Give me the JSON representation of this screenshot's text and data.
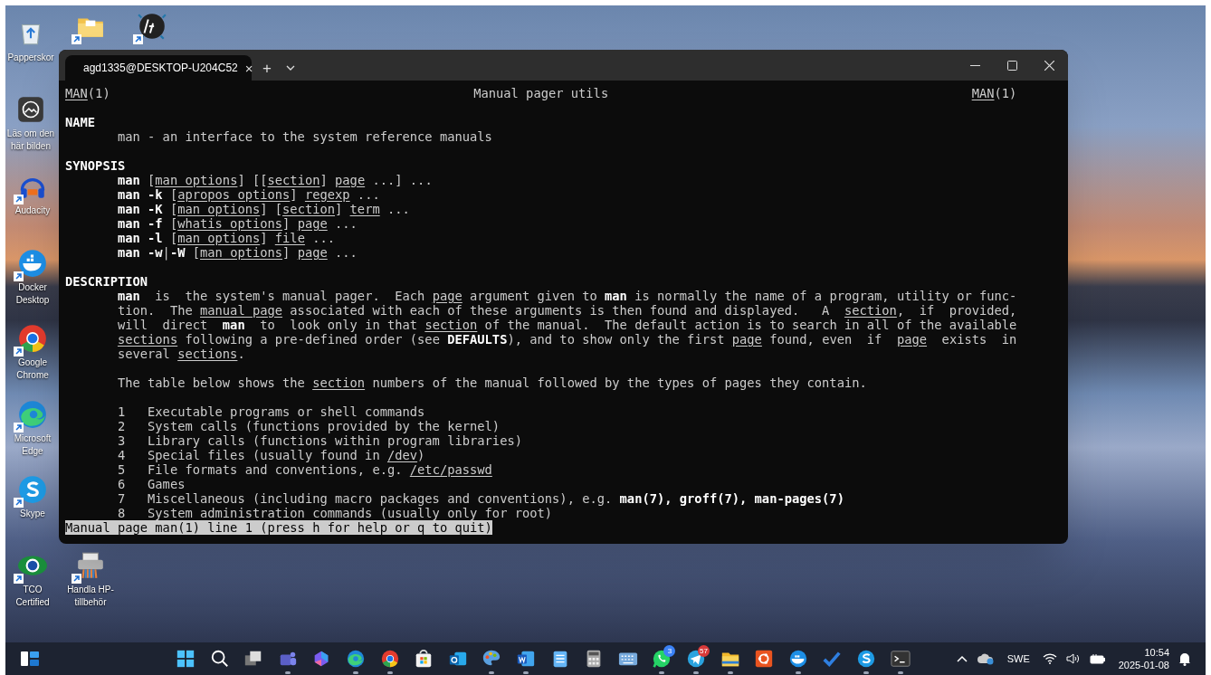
{
  "desktop_icons": [
    {
      "label": "Papperskor",
      "shortcut": false
    },
    {
      "label": "Läs om den här bilden",
      "shortcut": false
    },
    {
      "label": "Audacity",
      "shortcut": true
    },
    {
      "label": "Docker Desktop",
      "shortcut": true
    },
    {
      "label": "Google Chrome",
      "shortcut": true
    },
    {
      "label": "Microsoft Edge",
      "shortcut": true
    },
    {
      "label": "Skype",
      "shortcut": true
    },
    {
      "label": "TCO Certified",
      "shortcut": true
    },
    {
      "shortcut": true
    },
    {
      "shortcut": true
    },
    {
      "label": "Handla HP-tillbehör",
      "shortcut": true
    }
  ],
  "terminal": {
    "tab": {
      "title": "agd1335@DESKTOP-U204C52",
      "close": "×",
      "selected": true
    },
    "new_tab": "+",
    "header": {
      "left": [
        {
          "text": "MAN",
          "kind": "underline"
        },
        {
          "text": "(1)",
          "kind": "plain"
        }
      ],
      "center": "Manual pager utils",
      "right": [
        {
          "text": "MAN",
          "kind": "underline"
        },
        {
          "text": "(1)",
          "kind": "plain"
        }
      ]
    },
    "sections": [
      {
        "heading": "NAME",
        "blocks": [
          [
            [
              {
                "text": "man - an interface to the system reference manuals",
                "kind": "plain"
              }
            ]
          ]
        ]
      },
      {
        "heading": "SYNOPSIS",
        "blocks": [
          [
            [
              {
                "text": "man",
                "kind": "bold"
              },
              {
                "text": " [",
                "kind": "plain"
              },
              {
                "text": "man options",
                "kind": "underline"
              },
              {
                "text": "] [[",
                "kind": "plain"
              },
              {
                "text": "section",
                "kind": "underline"
              },
              {
                "text": "] ",
                "kind": "plain"
              },
              {
                "text": "page",
                "kind": "underline"
              },
              {
                "text": " ...] ...",
                "kind": "plain"
              }
            ],
            [
              {
                "text": "man -k",
                "kind": "bold"
              },
              {
                "text": " [",
                "kind": "plain"
              },
              {
                "text": "apropos options",
                "kind": "underline"
              },
              {
                "text": "] ",
                "kind": "plain"
              },
              {
                "text": "regexp",
                "kind": "underline"
              },
              {
                "text": " ...",
                "kind": "plain"
              }
            ],
            [
              {
                "text": "man -K",
                "kind": "bold"
              },
              {
                "text": " [",
                "kind": "plain"
              },
              {
                "text": "man options",
                "kind": "underline"
              },
              {
                "text": "] [",
                "kind": "plain"
              },
              {
                "text": "section",
                "kind": "underline"
              },
              {
                "text": "] ",
                "kind": "plain"
              },
              {
                "text": "term",
                "kind": "underline"
              },
              {
                "text": " ...",
                "kind": "plain"
              }
            ],
            [
              {
                "text": "man -f",
                "kind": "bold"
              },
              {
                "text": " [",
                "kind": "plain"
              },
              {
                "text": "whatis options",
                "kind": "underline"
              },
              {
                "text": "] ",
                "kind": "plain"
              },
              {
                "text": "page",
                "kind": "underline"
              },
              {
                "text": " ...",
                "kind": "plain"
              }
            ],
            [
              {
                "text": "man -l",
                "kind": "bold"
              },
              {
                "text": " [",
                "kind": "plain"
              },
              {
                "text": "man options",
                "kind": "underline"
              },
              {
                "text": "] ",
                "kind": "plain"
              },
              {
                "text": "file",
                "kind": "underline"
              },
              {
                "text": " ...",
                "kind": "plain"
              }
            ],
            [
              {
                "text": "man -w",
                "kind": "bold"
              },
              {
                "text": "|",
                "kind": "plain"
              },
              {
                "text": "-W",
                "kind": "bold"
              },
              {
                "text": " [",
                "kind": "plain"
              },
              {
                "text": "man options",
                "kind": "underline"
              },
              {
                "text": "] ",
                "kind": "plain"
              },
              {
                "text": "page",
                "kind": "underline"
              },
              {
                "text": " ...",
                "kind": "plain"
              }
            ]
          ]
        ]
      },
      {
        "heading": "DESCRIPTION",
        "blocks": [
          [
            [
              {
                "text": "man",
                "kind": "bold"
              },
              {
                "text": "  is  the system's manual pager.  Each ",
                "kind": "plain"
              },
              {
                "text": "page",
                "kind": "underline"
              },
              {
                "text": " argument given to ",
                "kind": "plain"
              },
              {
                "text": "man",
                "kind": "bold"
              },
              {
                "text": " is normally the name of a program, utility or func-",
                "kind": "plain"
              }
            ],
            [
              {
                "text": "tion.  The ",
                "kind": "plain"
              },
              {
                "text": "manual page",
                "kind": "underline"
              },
              {
                "text": " associated with each of these arguments is then found and displayed.   A  ",
                "kind": "plain"
              },
              {
                "text": "section",
                "kind": "underline"
              },
              {
                "text": ",  if  provided,",
                "kind": "plain"
              }
            ],
            [
              {
                "text": "will  direct  ",
                "kind": "plain"
              },
              {
                "text": "man",
                "kind": "bold"
              },
              {
                "text": "  to  look only in that ",
                "kind": "plain"
              },
              {
                "text": "section",
                "kind": "underline"
              },
              {
                "text": " of the manual.  The default action is to search in all of the available",
                "kind": "plain"
              }
            ],
            [
              {
                "text": "sections",
                "kind": "underline"
              },
              {
                "text": " following a pre-defined order (see ",
                "kind": "plain"
              },
              {
                "text": "DEFAULTS",
                "kind": "bold"
              },
              {
                "text": "), and to show only the first ",
                "kind": "plain"
              },
              {
                "text": "page",
                "kind": "underline"
              },
              {
                "text": " found, even  if  ",
                "kind": "plain"
              },
              {
                "text": "page",
                "kind": "underline"
              },
              {
                "text": "  exists  in",
                "kind": "plain"
              }
            ],
            [
              {
                "text": "several ",
                "kind": "plain"
              },
              {
                "text": "sections",
                "kind": "underline"
              },
              {
                "text": ".",
                "kind": "plain"
              }
            ]
          ],
          [
            [
              {
                "text": "The table below shows the ",
                "kind": "plain"
              },
              {
                "text": "section",
                "kind": "underline"
              },
              {
                "text": " numbers of the manual followed by the types of pages they contain.",
                "kind": "plain"
              }
            ]
          ],
          [
            [
              {
                "text": "1   Executable programs or shell commands",
                "kind": "plain"
              }
            ],
            [
              {
                "text": "2   System calls (functions provided by the kernel)",
                "kind": "plain"
              }
            ],
            [
              {
                "text": "3   Library calls (functions within program libraries)",
                "kind": "plain"
              }
            ],
            [
              {
                "text": "4   Special files (usually found in ",
                "kind": "plain"
              },
              {
                "text": "/dev",
                "kind": "underline"
              },
              {
                "text": ")",
                "kind": "plain"
              }
            ],
            [
              {
                "text": "5   File formats and conventions, e.g. ",
                "kind": "plain"
              },
              {
                "text": "/etc/passwd",
                "kind": "underline"
              }
            ],
            [
              {
                "text": "6   Games",
                "kind": "plain"
              }
            ],
            [
              {
                "text": "7   Miscellaneous (including macro packages and conventions), e.g. ",
                "kind": "plain"
              },
              {
                "text": "man(7), groff(7), man-pages(7)",
                "kind": "bold"
              }
            ],
            [
              {
                "text": "8   System administration commands (usually only for root)",
                "kind": "plain"
              }
            ]
          ]
        ]
      }
    ],
    "status_line": "Manual page man(1) line 1 (press h for help or q to quit)"
  },
  "taskbar": {
    "apps": [
      {
        "running": false
      },
      {
        "running": false
      },
      {
        "running": false
      },
      {
        "running": true
      },
      {
        "running": false
      },
      {
        "running": true
      },
      {
        "running": true
      },
      {
        "running": false
      },
      {
        "running": false
      },
      {
        "running": true
      },
      {
        "running": true
      },
      {
        "running": false
      },
      {
        "running": false
      },
      {
        "running": false
      },
      {
        "running": true,
        "badge": "3"
      },
      {
        "running": true,
        "badge": "57"
      },
      {
        "running": true
      },
      {
        "running": false
      },
      {
        "running": true
      },
      {
        "running": false
      },
      {
        "running": true
      },
      {
        "running": true
      }
    ],
    "tray": {
      "language": "SWE",
      "time": "10:54",
      "date": "2025-01-08"
    }
  }
}
